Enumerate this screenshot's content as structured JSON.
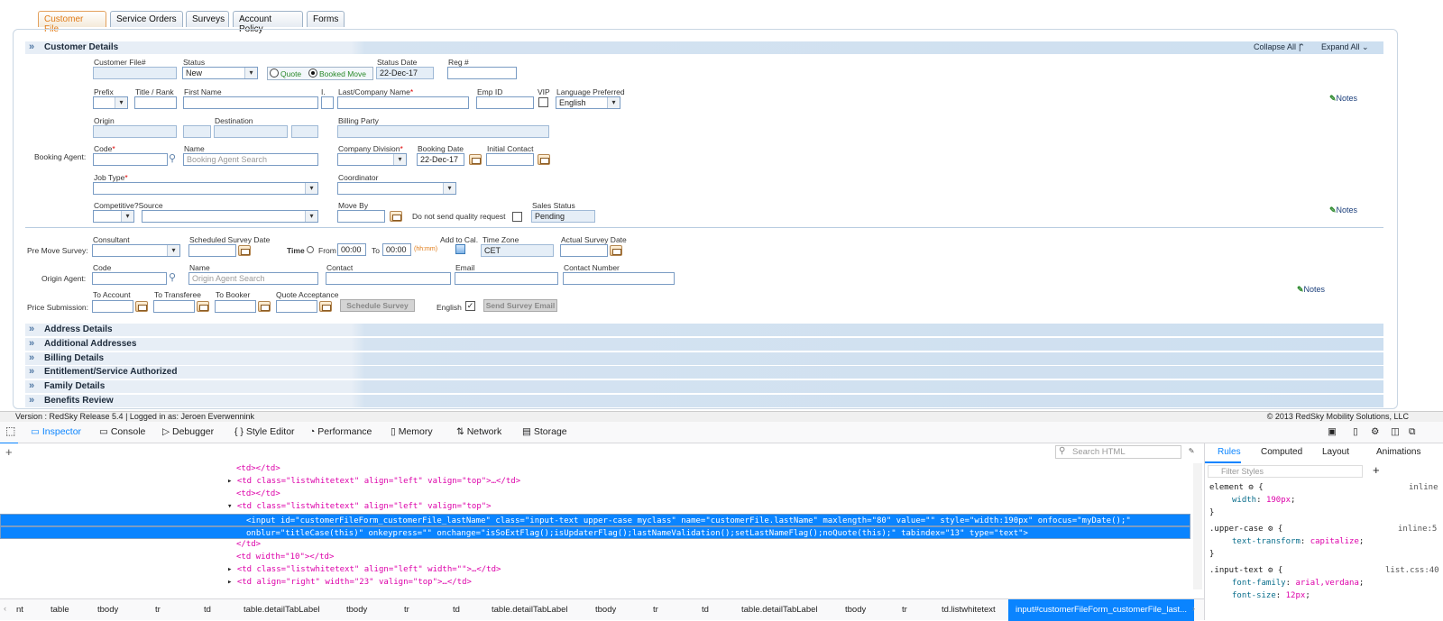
{
  "tabs": [
    "Customer File",
    "Service Orders",
    "Surveys",
    "Account Policy",
    "Forms"
  ],
  "customer_details": {
    "title": "Customer Details",
    "collapse_all": "Collapse All",
    "expand_all": "Expand All",
    "file_label": "Customer File#",
    "status_label": "Status",
    "status_value": "New",
    "quote_label": "Quote",
    "booked_label": "Booked Move",
    "status_date_label": "Status Date",
    "status_date_value": "22-Dec-17",
    "reg_label": "Reg #",
    "prefix_label": "Prefix",
    "title_label": "Title / Rank",
    "first_name_label": "First Name",
    "initial_label": "I.",
    "last_name_label": "Last/Company Name",
    "emp_id_label": "Emp ID",
    "vip_label": "VIP",
    "language_label": "Language Preferred",
    "language_value": "English",
    "notes_label": "Notes",
    "origin_label": "Origin",
    "destination_label": "Destination",
    "billing_party_label": "Billing Party",
    "booking_agent_label": "Booking Agent:",
    "code_label": "Code",
    "name_label": "Name",
    "name_placeholder": "Booking Agent Search",
    "company_division_label": "Company Division",
    "booking_date_label": "Booking Date",
    "booking_date_value": "22-Dec-17",
    "initial_contact_label": "Initial Contact",
    "job_type_label": "Job Type",
    "coordinator_label": "Coordinator",
    "competitive_label": "Competitive?",
    "source_label": "Source",
    "move_by_label": "Move By",
    "quality_request_label": "Do not send quality request",
    "sales_status_label": "Sales Status",
    "sales_status_value": "Pending"
  },
  "survey": {
    "consultant_label": "Consultant",
    "scheduled_date_label": "Scheduled Survey Date",
    "pre_move_label": "Pre Move Survey:",
    "time_label": "Time",
    "from_label": "From",
    "from_value": "00:00",
    "to_label": "To",
    "to_value": "00:00",
    "hhmm_label": "(hh:mm)",
    "add_cal_label": "Add to Cal.",
    "timezone_label": "Time Zone",
    "timezone_value": "CET",
    "actual_date_label": "Actual Survey Date",
    "origin_agent_label": "Origin Agent:",
    "code_label": "Code",
    "name_label": "Name",
    "name_placeholder": "Origin Agent Search",
    "contact_label": "Contact",
    "email_label": "Email",
    "contact_number_label": "Contact Number",
    "notes_label": "Notes",
    "price_submission_label": "Price Submission:",
    "to_account_label": "To Account",
    "to_transferee_label": "To Transferee",
    "to_booker_label": "To Booker",
    "quote_acceptance_label": "Quote Acceptance",
    "schedule_survey_button": "Schedule Survey",
    "english_label": "English",
    "send_email_button": "Send Survey Email"
  },
  "sections": [
    "Address Details",
    "Additional Addresses",
    "Billing Details",
    "Entitlement/Service Authorized",
    "Family Details",
    "Benefits Review"
  ],
  "status_bar": {
    "left": "Version : RedSky Release 5.4 | Logged in as: Jeroen Everwennink",
    "right": "© 2013 RedSky Mobility Solutions, LLC"
  },
  "devtools": {
    "tabs": [
      "Inspector",
      "Console",
      "Debugger",
      "Style Editor",
      "Performance",
      "Memory",
      "Network",
      "Storage"
    ],
    "search_placeholder": "Search HTML",
    "code_lines": [
      "<td></td>",
      "<td class=\"listwhitetext\" align=\"left\" valign=\"top\">…</td>",
      "<td></td>",
      "<td class=\"listwhitetext\" align=\"left\" valign=\"top\">",
      "<input id=\"customerFileForm_customerFile_lastName\" class=\"input-text upper-case myclass\" name=\"customerFile.lastName\" maxlength=\"80\" value=\"\" style=\"width:190px\" onfocus=\"myDate();\"",
      "onblur=\"titleCase(this)\" onkeypress=\"\" onchange=\"isSoExtFlag();isUpdaterFlag();lastNameValidation();setLastNameFlag();noQuote(this);\" tabindex=\"13\" type=\"text\">",
      "</td>",
      "<td width=\"10\"></td>",
      "<td class=\"listwhitetext\" align=\"left\" width=\"\">…</td>",
      "<td align=\"right\" width=\"23\" valign=\"top\">…</td>"
    ],
    "breadcrumb": [
      "nt",
      "table",
      "tbody",
      "tr",
      "td",
      "table.detailTabLabel",
      "tbody",
      "tr",
      "td",
      "table.detailTabLabel",
      "tbody",
      "tr",
      "td",
      "table.detailTabLabel",
      "tbody",
      "tr",
      "td.listwhitetext",
      "input#customerFileForm_customerFile_last..."
    ],
    "rules_tabs": [
      "Rules",
      "Computed",
      "Layout",
      "Animations"
    ],
    "filter_placeholder": "Filter Styles",
    "rules": [
      {
        "selector": "element",
        "source": "inline",
        "prop": "width",
        "value": "190px"
      },
      {
        "selector": ".upper-case",
        "source": "inline:5",
        "prop": "text-transform",
        "value": "capitalize"
      },
      {
        "selector": ".input-text",
        "source": "list.css:40",
        "prop": "font-family",
        "value": "arial,verdana",
        "prop2": "font-size",
        "value2": "12px"
      }
    ]
  }
}
